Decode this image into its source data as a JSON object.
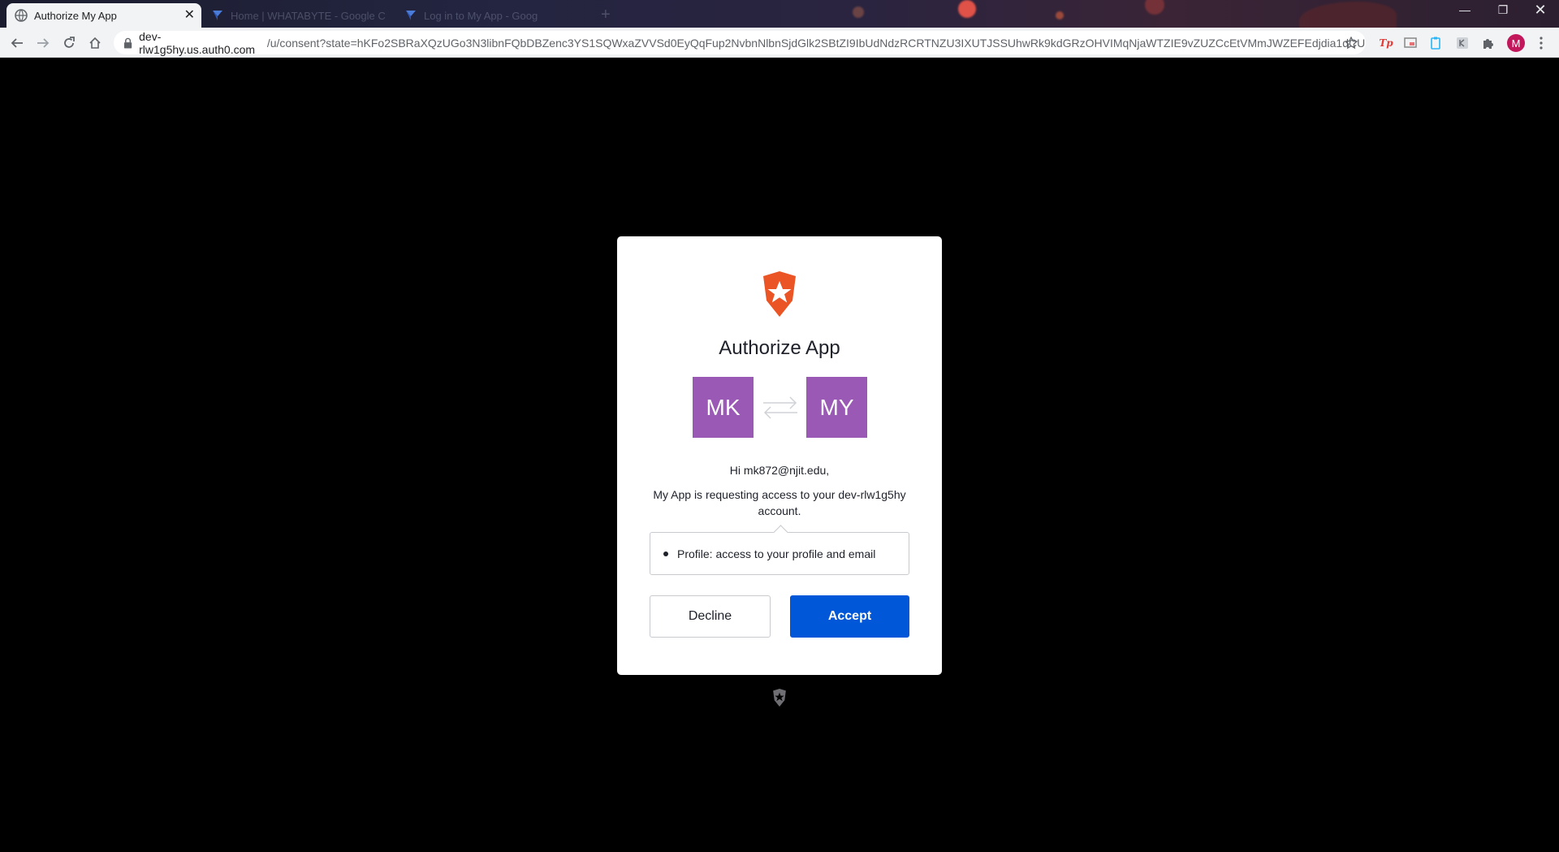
{
  "browser": {
    "tabs": [
      {
        "title": "Authorize My App",
        "active": true
      },
      {
        "title": "Home | WHATABYTE - Google C",
        "active": false
      },
      {
        "title": "Log in to My App - Goog",
        "active": false
      }
    ],
    "url_host": "dev-rlw1g5hy.us.auth0.com",
    "url_path": "/u/consent?state=hKFo2SBRaXQzUGo3N3libnFQbDBZenc3YS1SQWxaZVVSd0EyQqFup2NvbnNlbnSjdGlk2SBtZI9IbUdNdzRCRTNZU3IXUTJSSUhwRk9kdGRzOHVIMqNjaWTZIE9vZUZCcEtVMmJWZEFEdjdia1dCUm...",
    "profile_initial": "M",
    "tp_ext_label": "Tp"
  },
  "consent": {
    "title": "Authorize App",
    "user_initials": "MK",
    "app_initials": "MY",
    "greeting": "Hi mk872@njit.edu,",
    "request": "My App is requesting access to your dev-rlw1g5hy account.",
    "scopes": [
      {
        "label": "Profile: access to your profile and email"
      }
    ],
    "decline_label": "Decline",
    "accept_label": "Accept"
  },
  "colors": {
    "accent": "#0057d8",
    "avatar": "#9b59b6",
    "brand": "#eb5424"
  },
  "icons": [
    "globe-icon",
    "back-arrow-icon",
    "forward-arrow-icon",
    "reload-icon",
    "home-icon",
    "lock-icon",
    "star-icon",
    "extensions-puzzle-icon",
    "more-vert-icon",
    "auth0-shield-logo",
    "exchange-arrows-icon"
  ]
}
